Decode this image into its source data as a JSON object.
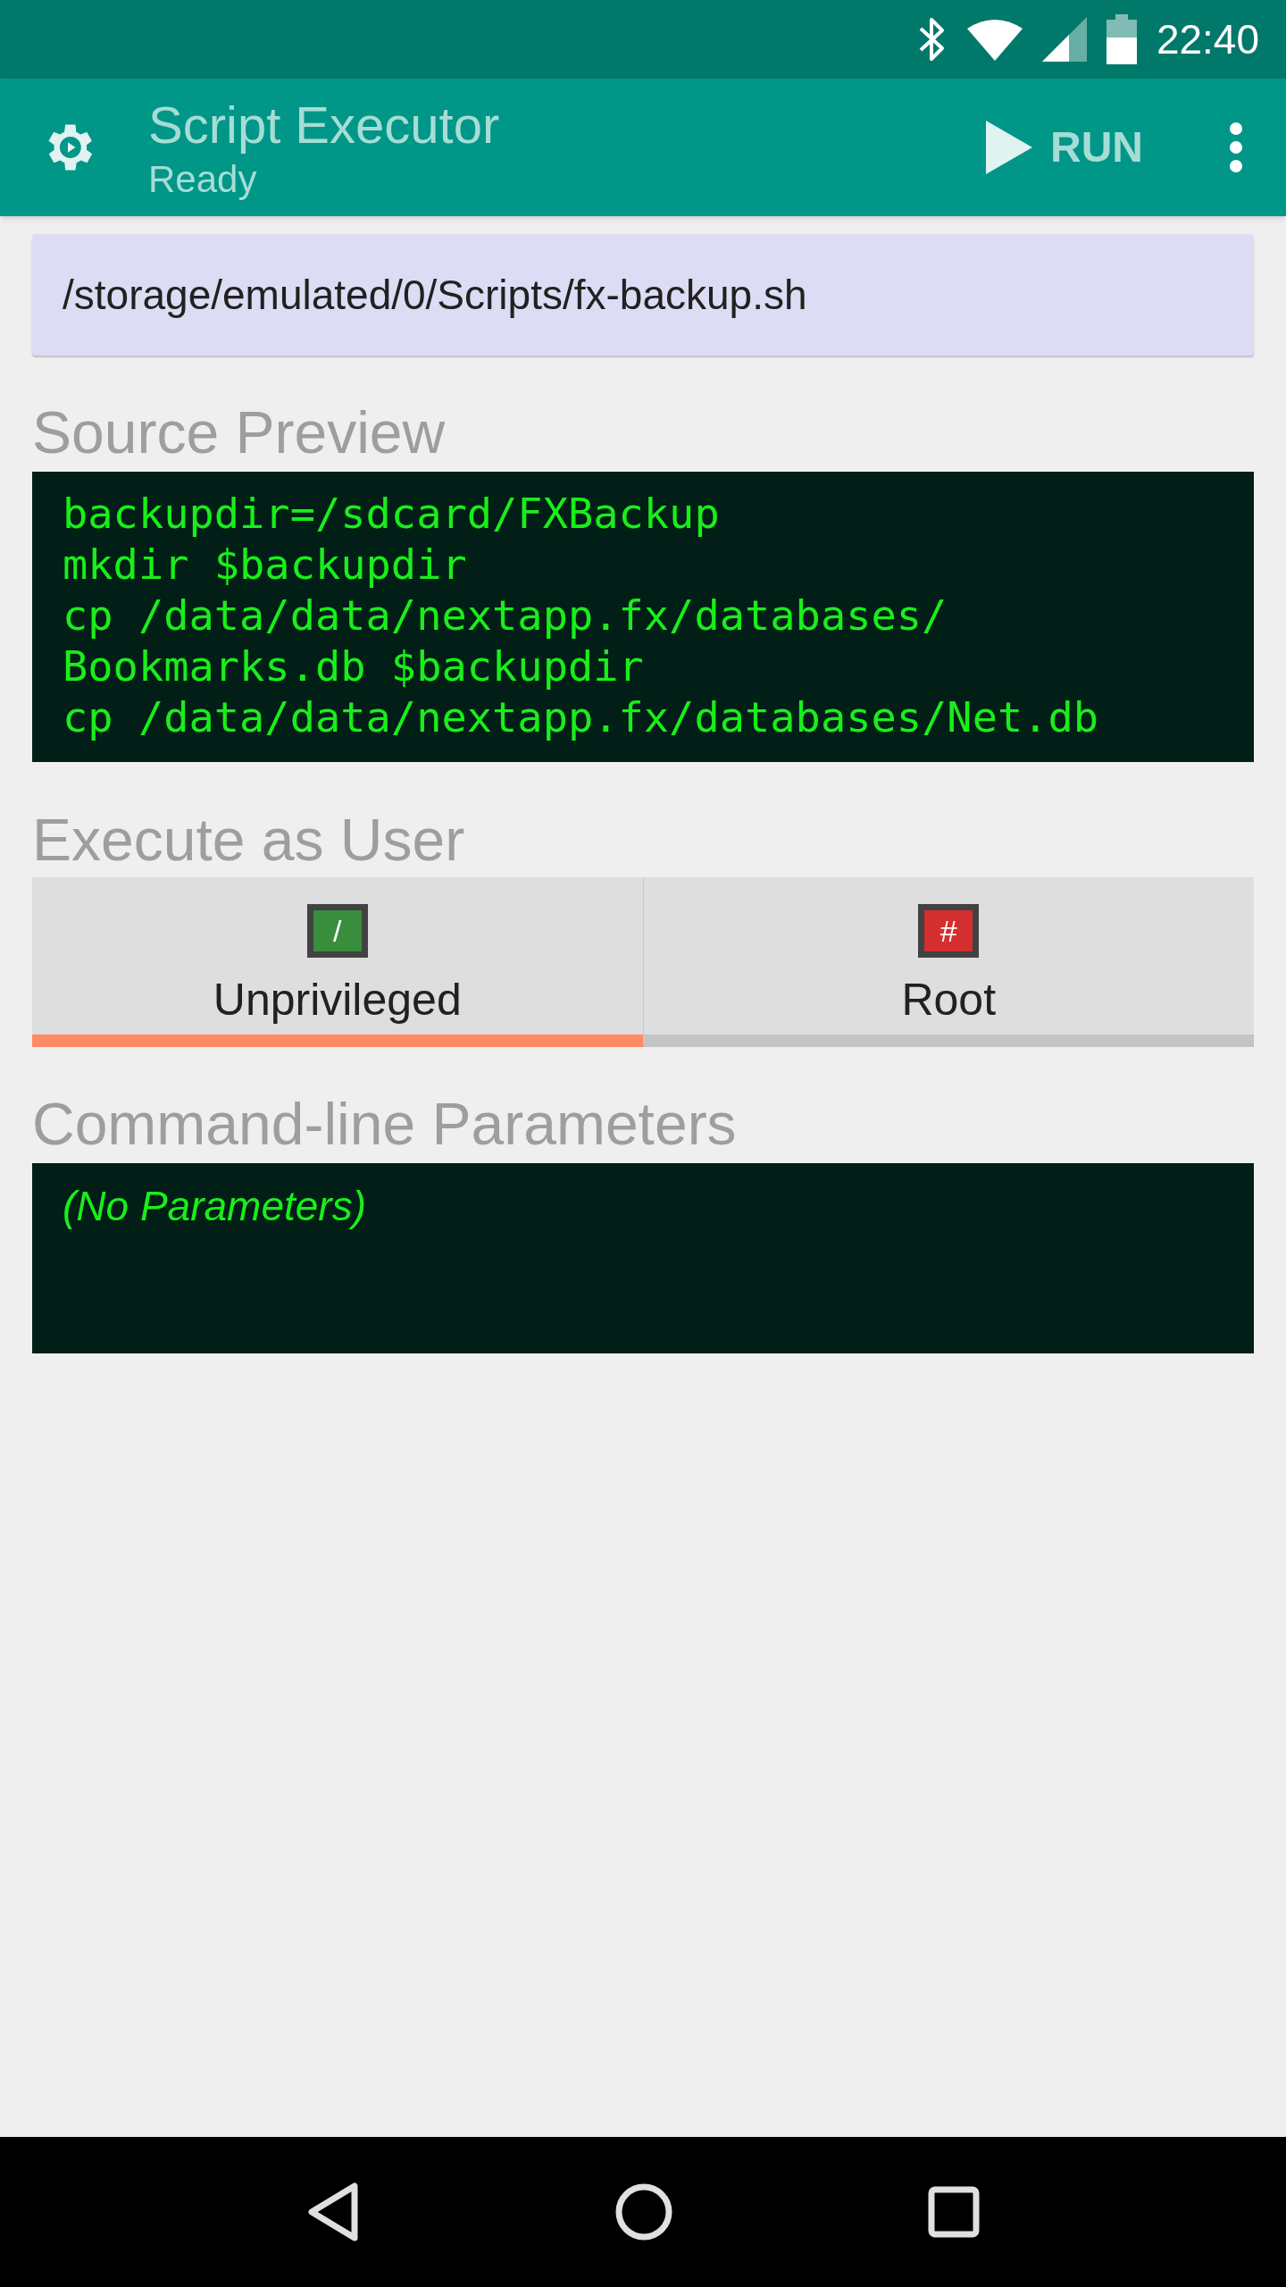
{
  "status_bar": {
    "time": "22:40"
  },
  "app_bar": {
    "title": "Script Executor",
    "subtitle": "Ready",
    "action": "RUN"
  },
  "path_field": {
    "value": "/storage/emulated/0/Scripts/fx-backup.sh"
  },
  "source_preview": {
    "heading": "Source Preview",
    "lines": [
      "backupdir=/sdcard/FXBackup",
      "mkdir $backupdir",
      "cp /data/data/nextapp.fx/databases/",
      "Bookmarks.db $backupdir",
      "cp /data/data/nextapp.fx/databases/Net.db"
    ]
  },
  "execute_as": {
    "heading": "Execute as User",
    "tabs": [
      {
        "label": "Unprivileged",
        "glyph": "/",
        "color": "#388e3c",
        "selected": true
      },
      {
        "label": "Root",
        "glyph": "#",
        "color": "#d32f2f",
        "selected": false
      }
    ]
  },
  "parameters": {
    "heading": "Command-line Parameters",
    "placeholder": "(No Parameters)"
  }
}
